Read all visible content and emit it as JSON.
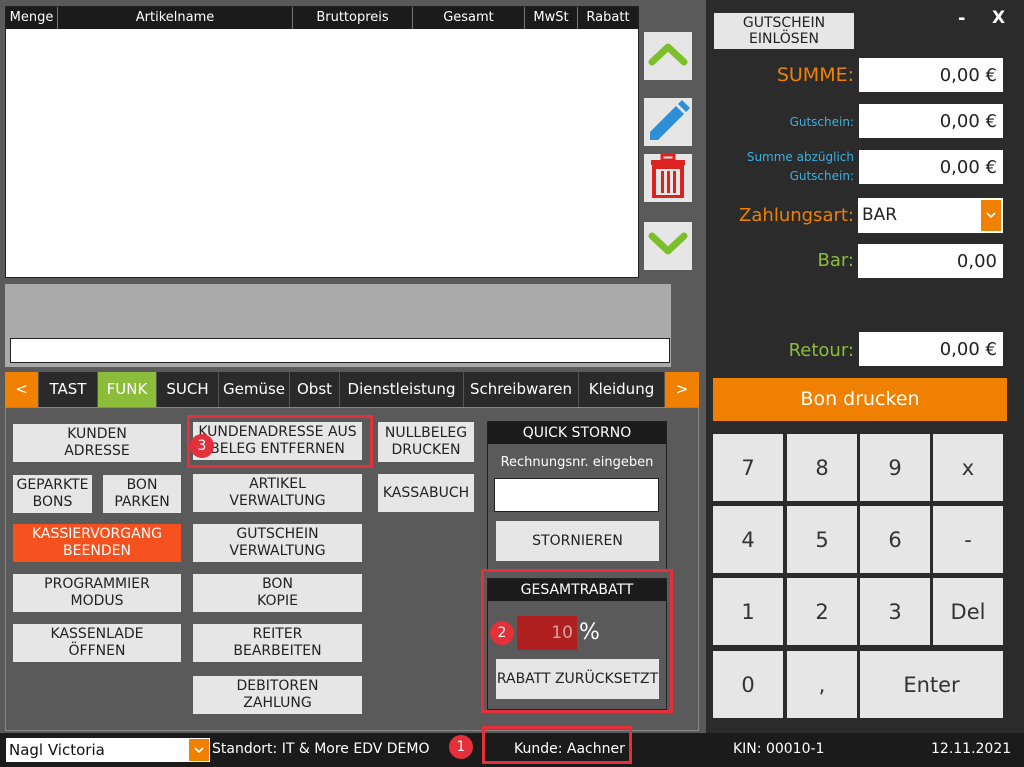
{
  "table": {
    "columns": [
      "Menge",
      "Artikelname",
      "Bruttopreis",
      "Gesamt",
      "MwSt",
      "Rabatt"
    ]
  },
  "icons": {
    "up": "chevron-up-icon",
    "edit": "pencil-icon",
    "delete": "trash-icon",
    "down": "chevron-down-icon"
  },
  "tabs": {
    "prev": "<",
    "items": [
      "TAST",
      "FUNK",
      "SUCH",
      "Gemüse",
      "Obst",
      "Dienstleistung",
      "Schreibwaren",
      "Kleidung"
    ],
    "next": ">"
  },
  "functions": {
    "kunden_adresse": "KUNDEN\nADRESSE",
    "kundenadresse_entfernen": "KUNDENADRESSE AUS\nBELEG ENTFERNEN",
    "nullbeleg": "NULLBELEG\nDRUCKEN",
    "geparkte_bons": "GEPARKTE\nBONS",
    "bon_parken": "BON\nPARKEN",
    "artikel_verwaltung": "ARTIKEL\nVERWALTUNG",
    "kassabuch": "KASSABUCH",
    "kassiervorgang": "KASSIERVORGANG\nBEENDEN",
    "gutschein_verwaltung": "GUTSCHEIN\nVERWALTUNG",
    "programmier_modus": "PROGRAMMIER\nMODUS",
    "bon_kopie": "BON\nKOPIE",
    "kassenlade": "KASSENLADE\nÖFFNEN",
    "reiter": "REITER\nBEARBEITEN",
    "debitoren": "DEBITOREN\nZAHLUNG"
  },
  "quick_storno": {
    "title": "QUICK STORNO",
    "label": "Rechnungsnr. eingeben",
    "input_value": "",
    "button": "STORNIEREN"
  },
  "gesamtrabatt": {
    "title": "GESAMTRABATT",
    "value": "10",
    "unit": "%",
    "reset_button": "RABATT ZURÜCKSETZT"
  },
  "badges": [
    "1",
    "2",
    "3"
  ],
  "right": {
    "gutschein_button": "GUTSCHEIN\nEINLÖSEN",
    "minimize": "-",
    "close": "X",
    "summe_label": "SUMME:",
    "summe_value": "0,00 €",
    "gutschein_label": "Gutschein:",
    "gutschein_value": "0,00 €",
    "summe_abzgl_label": "Summe abzüglich\nGutschein:",
    "summe_abzgl_value": "0,00 €",
    "zahlungsart_label": "Zahlungsart:",
    "zahlungsart_value": "BAR",
    "bar_label": "Bar:",
    "bar_value": "0,00",
    "retour_label": "Retour:",
    "retour_value": "0,00 €",
    "bon_drucken": "Bon drucken"
  },
  "numpad": [
    "7",
    "8",
    "9",
    "x",
    "4",
    "5",
    "6",
    "-",
    "1",
    "2",
    "3",
    "Del",
    "0",
    ",",
    "Enter"
  ],
  "footer": {
    "user": "Nagl Victoria",
    "standort": "Standort: IT & More EDV DEMO",
    "kunde": "Kunde: Aachner",
    "kin": "KIN: 00010-1",
    "date": "12.11.2021"
  },
  "colors": {
    "accent_orange": "#f08000",
    "accent_green": "#8bbd3a",
    "highlight_red": "#e3303a",
    "link_blue": "#3ab0e0",
    "cta_red": "#f4511e"
  }
}
